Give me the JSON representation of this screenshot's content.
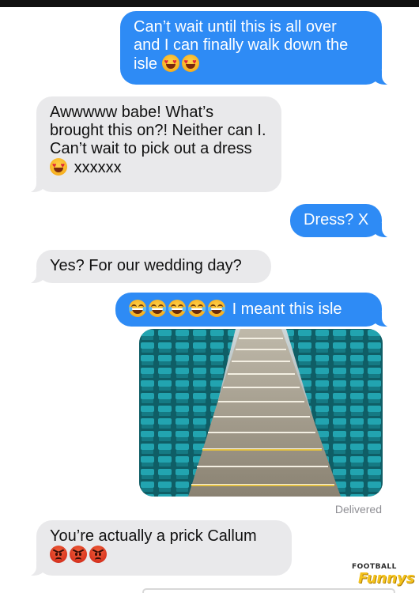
{
  "conversation": {
    "messages": [
      {
        "sender": "me",
        "lines": [
          "Can’t wait until this is all over",
          "and I can finally walk down the",
          "isle"
        ],
        "emoji": [
          "heart-eyes",
          "heart-eyes"
        ]
      },
      {
        "sender": "them",
        "lines": [
          "Awwwww babe! What’s",
          "brought this on?! Neither can I.",
          "Can’t wait to pick out a dress",
          "xxxxxx"
        ],
        "emoji": [
          "heart-eyes"
        ]
      },
      {
        "sender": "me",
        "lines": [
          "Dress? X"
        ]
      },
      {
        "sender": "them",
        "lines": [
          "Yes? For our wedding day?"
        ]
      },
      {
        "sender": "me",
        "lines": [
          "I meant this isle"
        ],
        "emoji": [
          "tears-of-joy",
          "tears-of-joy",
          "tears-of-joy",
          "tears-of-joy",
          "tears-of-joy"
        ]
      },
      {
        "sender": "me",
        "type": "image",
        "image": "stadium-stairs-photo"
      },
      {
        "sender": "them",
        "lines": [
          "You’re actually a prick Callum"
        ],
        "emoji": [
          "angry-face",
          "angry-face",
          "angry-face"
        ]
      }
    ],
    "delivered_label": "Delivered"
  },
  "watermark": {
    "top": "FOOTBALL",
    "bottom": "Funnys"
  },
  "colors": {
    "sent_bubble": "#2e8bf5",
    "received_bubble": "#e9e9eb",
    "seat_teal": "#1f9aa6",
    "watermark_yellow": "#f4c21b"
  }
}
